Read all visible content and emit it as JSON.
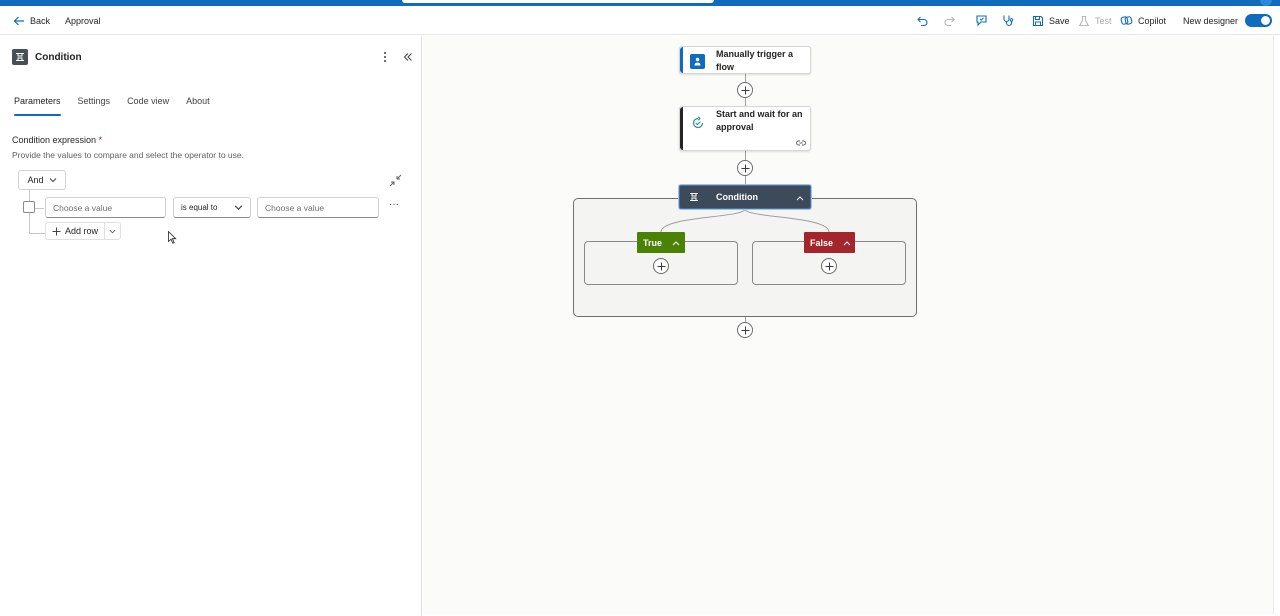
{
  "header": {
    "back_label": "Back",
    "flow_name": "Approval",
    "save_label": "Save",
    "test_label": "Test",
    "copilot_label": "Copilot",
    "new_designer_label": "New designer",
    "new_designer_on": true
  },
  "panel": {
    "title": "Condition",
    "tabs": [
      {
        "label": "Parameters",
        "active": true
      },
      {
        "label": "Settings",
        "active": false
      },
      {
        "label": "Code view",
        "active": false
      },
      {
        "label": "About",
        "active": false
      }
    ],
    "field_label": "Condition expression",
    "required_mark": "*",
    "field_help": "Provide the values to compare and select the operator to use.",
    "group_operator": "And",
    "row": {
      "left_placeholder": "Choose a value",
      "operator": "is equal to",
      "right_placeholder": "Choose a value"
    },
    "add_row_label": "Add row"
  },
  "canvas": {
    "trigger_title": "Manually trigger a flow",
    "approval_title": "Start and wait for an approval",
    "condition_title": "Condition",
    "true_label": "True",
    "false_label": "False"
  },
  "colors": {
    "brand": "#0f6cbd",
    "true_branch": "#498205",
    "false_branch": "#a4262c",
    "condition_header": "#3c4a5a"
  }
}
